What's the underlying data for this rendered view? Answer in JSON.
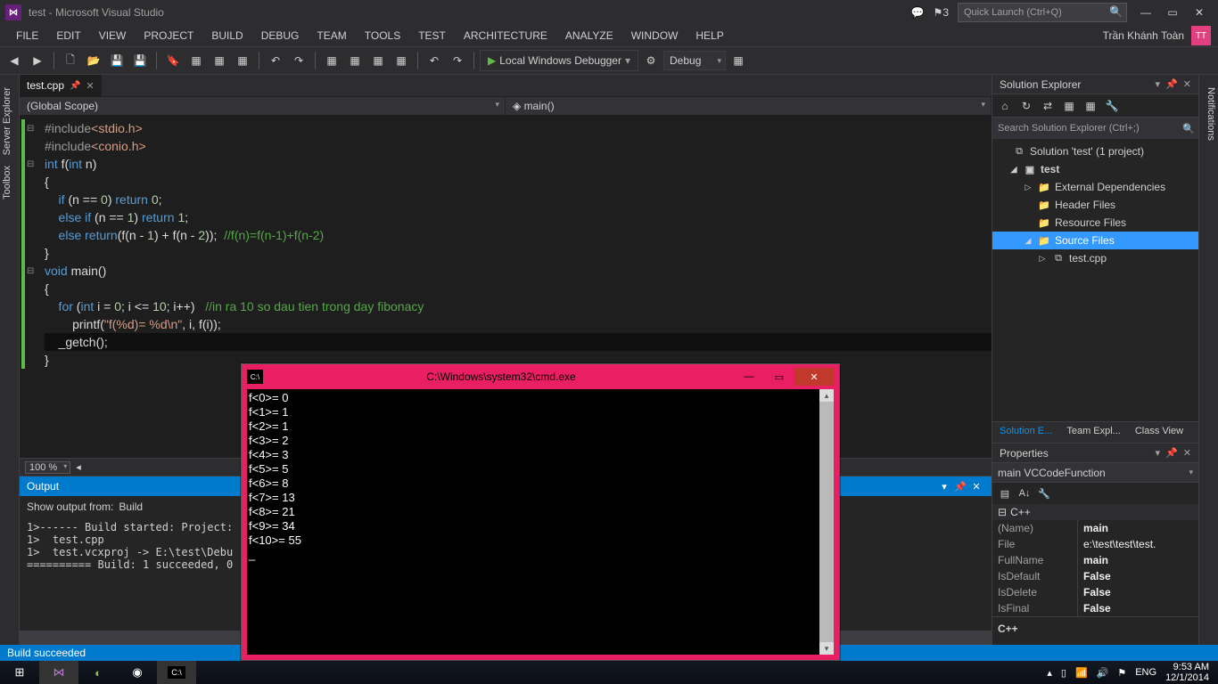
{
  "titlebar": {
    "title": "test - Microsoft Visual Studio",
    "notif_count": "3",
    "quick_launch_placeholder": "Quick Launch (Ctrl+Q)"
  },
  "user": {
    "name": "Trần Khánh Toàn",
    "initials": "TT"
  },
  "menu": [
    "FILE",
    "EDIT",
    "VIEW",
    "PROJECT",
    "BUILD",
    "DEBUG",
    "TEAM",
    "TOOLS",
    "TEST",
    "ARCHITECTURE",
    "ANALYZE",
    "WINDOW",
    "HELP"
  ],
  "toolbar": {
    "debug_label": "Local Windows Debugger",
    "config": "Debug"
  },
  "left_tabs": [
    "Server Explorer",
    "Toolbox"
  ],
  "right_tabs": [
    "Notifications"
  ],
  "editor": {
    "tab_name": "test.cpp",
    "scope_left": "(Global Scope)",
    "scope_right": "main()",
    "zoom": "100 %",
    "code": {
      "l1a": "#include",
      "l1b": "<stdio.h>",
      "l2a": "#include",
      "l2b": "<conio.h>",
      "l3": "int f(int n)",
      "l4": "{",
      "l5a": "    if",
      "l5b": " (n == ",
      "l5c": "0",
      "l5d": ") ",
      "l5e": "return",
      "l5f": " ",
      "l5g": "0",
      "l5h": ";",
      "l6a": "    else if",
      "l6b": " (n == ",
      "l6c": "1",
      "l6d": ") ",
      "l6e": "return",
      "l6f": " ",
      "l6g": "1",
      "l6h": ";",
      "l7a": "    else return",
      "l7b": "(f(n - ",
      "l7c": "1",
      "l7d": ") + f(n - ",
      "l7e": "2",
      "l7f": "));  ",
      "l7g": "//f(n)=f(n-1)+f(n-2)",
      "l8": "}",
      "l9": "void main()",
      "l10": "{",
      "l11a": "    for",
      "l11b": " (",
      "l11c": "int",
      "l11d": " i = ",
      "l11e": "0",
      "l11f": "; i <= ",
      "l11g": "10",
      "l11h": "; i++)   ",
      "l11i": "//in ra 10 so dau tien trong day fibonacy",
      "l12a": "        printf(",
      "l12b": "\"f(%d)= %d\\n\"",
      "l12c": ", i, f(i));",
      "l13": "    _getch();",
      "l14": "}"
    }
  },
  "output": {
    "title": "Output",
    "show_from_label": "Show output from:",
    "source": "Build",
    "text": "1>------ Build started: Project:\n1>  test.cpp\n1>  test.vcxproj -> E:\\test\\Debu\n========== Build: 1 succeeded, 0"
  },
  "solution_explorer": {
    "title": "Solution Explorer",
    "search_placeholder": "Search Solution Explorer (Ctrl+;)",
    "root": "Solution 'test' (1 project)",
    "project": "test",
    "folders": {
      "ext": "External Dependencies",
      "hdr": "Header Files",
      "res": "Resource Files",
      "src": "Source Files"
    },
    "file": "test.cpp",
    "tabs": [
      "Solution E...",
      "Team Expl...",
      "Class View"
    ]
  },
  "properties": {
    "title": "Properties",
    "object": "main  VCCodeFunction",
    "category": "C++",
    "rows": [
      {
        "name": "(Name)",
        "val": "main"
      },
      {
        "name": "File",
        "val": "e:\\test\\test\\test."
      },
      {
        "name": "FullName",
        "val": "main"
      },
      {
        "name": "IsDefault",
        "val": "False"
      },
      {
        "name": "IsDelete",
        "val": "False"
      },
      {
        "name": "IsFinal",
        "val": "False"
      }
    ],
    "desc_title": "C++"
  },
  "status": {
    "text": "Build succeeded"
  },
  "console": {
    "title": "C:\\Windows\\system32\\cmd.exe",
    "output": "f<0>= 0\nf<1>= 1\nf<2>= 1\nf<3>= 2\nf<4>= 3\nf<5>= 5\nf<6>= 8\nf<7>= 13\nf<8>= 21\nf<9>= 34\nf<10>= 55\n_"
  },
  "taskbar": {
    "lang": "ENG",
    "time": "9:53 AM",
    "date": "12/1/2014"
  }
}
